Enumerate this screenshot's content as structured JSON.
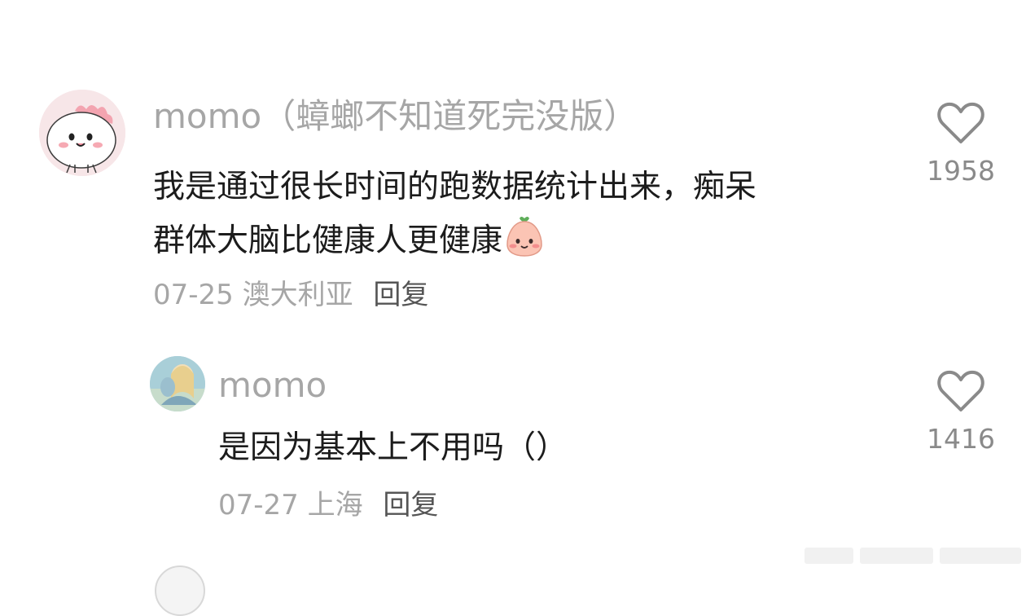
{
  "comments": [
    {
      "username": "momo（蟑螂不知道死完没版）",
      "text_line1": "我是通过很长时间的跑数据统计出来，痴呆",
      "text_line2": "群体大脑比健康人更健康",
      "emoji": "peach-face-emoji",
      "date": "07-25",
      "location": "澳大利亚",
      "reply_label": "回复",
      "likes": "1958"
    },
    {
      "username": "momo",
      "text": "是因为基本上不用吗（）",
      "date": "07-27",
      "location": "上海",
      "reply_label": "回复",
      "likes": "1416"
    }
  ],
  "colors": {
    "username": "#a6a6a6",
    "body_text": "#1c1c1c",
    "meta": "#a6a6a6",
    "reply": "#555555",
    "like_icon": "#8a8a8a"
  },
  "icons": {
    "like": "heart-outline-icon",
    "avatar_main": "cartoon-dinosaur-avatar",
    "avatar_reply": "anime-illustration-avatar"
  }
}
